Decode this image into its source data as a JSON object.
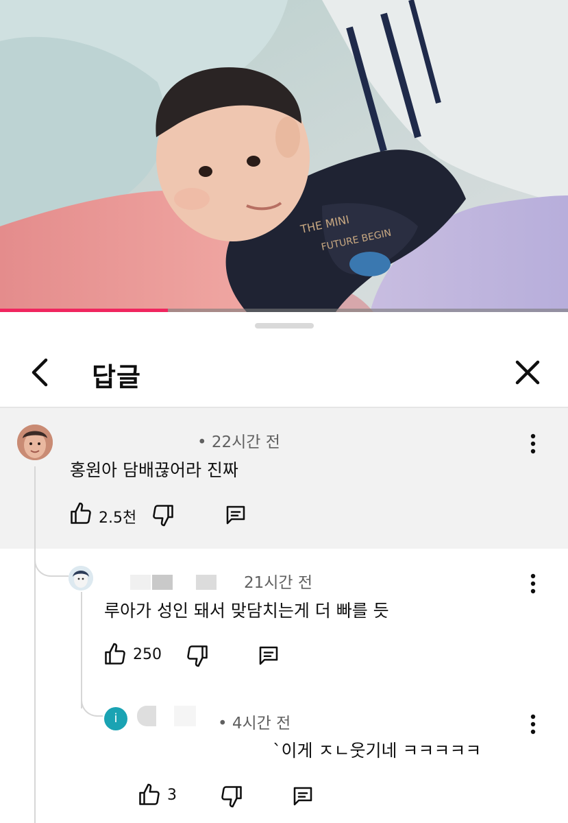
{
  "video": {
    "progress": 0.295,
    "accent": "#f0265f"
  },
  "header": {
    "title": "답글",
    "back_icon": "chevron-left-icon",
    "close_icon": "close-icon"
  },
  "comments": [
    {
      "time": "• 22시간 전",
      "text": "홍원아 담배끊어라 진짜",
      "likes": "2.5천"
    },
    {
      "time": "21시간 전",
      "text": "루아가 성인 돼서 맞담치는게 더 빠를 듯",
      "likes": "250"
    },
    {
      "time": "• 4시간 전",
      "text": "`이게 ㅈㄴ웃기네 ㅋㅋㅋㅋㅋ",
      "likes": "3",
      "avatar_letter": "i"
    }
  ]
}
